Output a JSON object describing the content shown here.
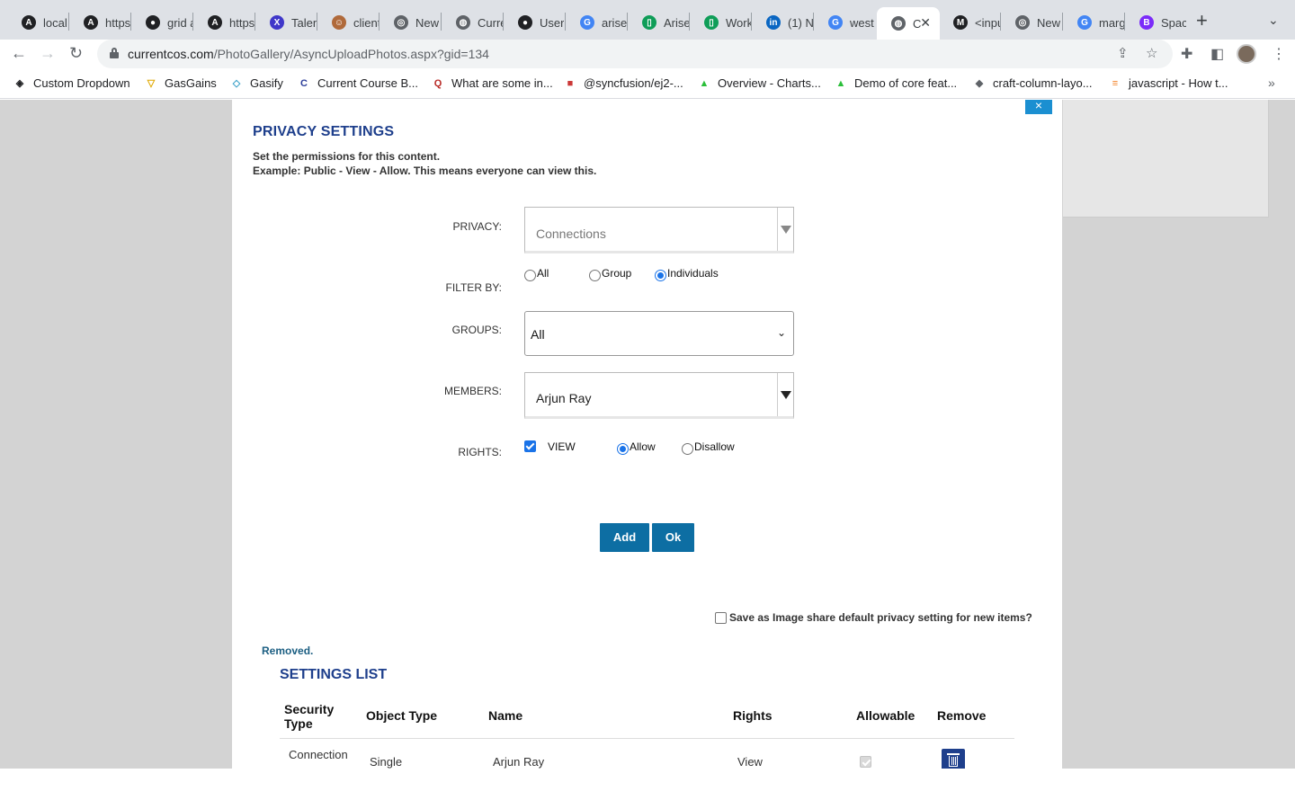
{
  "browser": {
    "tabs": [
      {
        "title": "local",
        "icon": "angular-icon",
        "color": "#202124",
        "glyph": "A"
      },
      {
        "title": "https",
        "icon": "angular-icon",
        "color": "#202124",
        "glyph": "A"
      },
      {
        "title": "grid a",
        "icon": "github-icon",
        "color": "#202124",
        "glyph": "●"
      },
      {
        "title": "https",
        "icon": "angular-icon",
        "color": "#202124",
        "glyph": "A"
      },
      {
        "title": "Talen",
        "icon": "x-brand-icon",
        "color": "#3f37c9",
        "glyph": "X"
      },
      {
        "title": "client",
        "icon": "person-icon",
        "color": "#b06a3b",
        "glyph": "☺"
      },
      {
        "title": "New",
        "icon": "chrome-icon",
        "color": "#5f6368",
        "glyph": "◎"
      },
      {
        "title": "Curre",
        "icon": "globe-icon",
        "color": "#5f6368",
        "glyph": "◍"
      },
      {
        "title": "User",
        "icon": "github-icon",
        "color": "#202124",
        "glyph": "●"
      },
      {
        "title": "arise",
        "icon": "google-icon",
        "color": "#4285f4",
        "glyph": "G"
      },
      {
        "title": "Arise",
        "icon": "sheet-icon",
        "color": "#0f9d58",
        "glyph": "▯"
      },
      {
        "title": "Work",
        "icon": "sheet-icon",
        "color": "#0f9d58",
        "glyph": "▯"
      },
      {
        "title": "(1) N",
        "icon": "linkedin-icon",
        "color": "#0a66c2",
        "glyph": "in"
      },
      {
        "title": "west",
        "icon": "google-icon",
        "color": "#4285f4",
        "glyph": "G"
      },
      {
        "title": "C",
        "icon": "globe-icon",
        "color": "#5f6368",
        "glyph": "◍",
        "active": true
      },
      {
        "title": "<inpu",
        "icon": "m-brand-icon",
        "color": "#202124",
        "glyph": "M"
      },
      {
        "title": "New",
        "icon": "chrome-icon",
        "color": "#5f6368",
        "glyph": "◎"
      },
      {
        "title": "marg",
        "icon": "google-icon",
        "color": "#4285f4",
        "glyph": "G"
      },
      {
        "title": "Spac",
        "icon": "bootstrap-icon",
        "color": "#7b2bf9",
        "glyph": "B"
      }
    ],
    "url_host": "currentcos.com",
    "url_path": "/PhotoGallery/AsyncUploadPhotos.aspx?gid=134",
    "bookmarks": [
      {
        "label": "Custom Dropdown",
        "icon": "codepen-icon",
        "color": "#202124",
        "glyph": "◈"
      },
      {
        "label": "GasGains",
        "icon": "gas-icon",
        "color": "#e0a800",
        "glyph": "▽"
      },
      {
        "label": "Gasify",
        "icon": "gasify-icon",
        "color": "#3aa0c8",
        "glyph": "◇"
      },
      {
        "label": "Current Course B...",
        "icon": "current-icon",
        "color": "#2c3e9a",
        "glyph": "C"
      },
      {
        "label": "What are some in...",
        "icon": "quora-icon",
        "color": "#b92b27",
        "glyph": "Q"
      },
      {
        "label": "@syncfusion/ej2-...",
        "icon": "npm-icon",
        "color": "#cb3837",
        "glyph": "■"
      },
      {
        "label": "Overview - Charts...",
        "icon": "chart-brand-icon",
        "color": "#2bbf3a",
        "glyph": "▲"
      },
      {
        "label": "Demo of core feat...",
        "icon": "chart-brand-icon",
        "color": "#2bbf3a",
        "glyph": "▲"
      },
      {
        "label": "craft-column-layo...",
        "icon": "package-icon",
        "color": "#5f6368",
        "glyph": "◆"
      },
      {
        "label": "javascript - How t...",
        "icon": "stackoverflow-icon",
        "color": "#f48024",
        "glyph": "≡"
      }
    ]
  },
  "modal": {
    "close_label": "×",
    "title": "PRIVACY SETTINGS",
    "desc_line1": "Set the permissions for this content.",
    "desc_line2": "Example: Public - View - Allow. This means everyone can view this.",
    "privacy_label": "PRIVACY:",
    "privacy_value": "Connections",
    "filter_label": "FILTER BY:",
    "filter_options": [
      "All",
      "Group",
      "Individuals"
    ],
    "filter_selected": "Individuals",
    "groups_label": "GROUPS:",
    "groups_value": "All",
    "members_label": "MEMBERS:",
    "members_value": "Arjun Ray",
    "rights_label": "RIGHTS:",
    "rights_view_label": "VIEW",
    "rights_view_checked": true,
    "rights_options": [
      "Allow",
      "Disallow"
    ],
    "rights_selected": "Allow",
    "add_label": "Add",
    "ok_label": "Ok",
    "save_default_label": "Save as Image share default privacy setting for new items?",
    "status_text": "Removed.",
    "list_title": "SETTINGS LIST",
    "columns": [
      "Security Type",
      "Object Type",
      "Name",
      "Rights",
      "Allowable",
      "Remove"
    ],
    "rows": [
      {
        "security_type": "Connection",
        "object_type": "Single",
        "name": "Arjun Ray",
        "rights": "View",
        "allowable": true
      }
    ]
  },
  "colors": {
    "title_blue": "#1e3f8c",
    "button_blue": "#0d6ea3",
    "close_blue": "#1b8fd1",
    "overlay_gray": "#d3d3d3"
  }
}
